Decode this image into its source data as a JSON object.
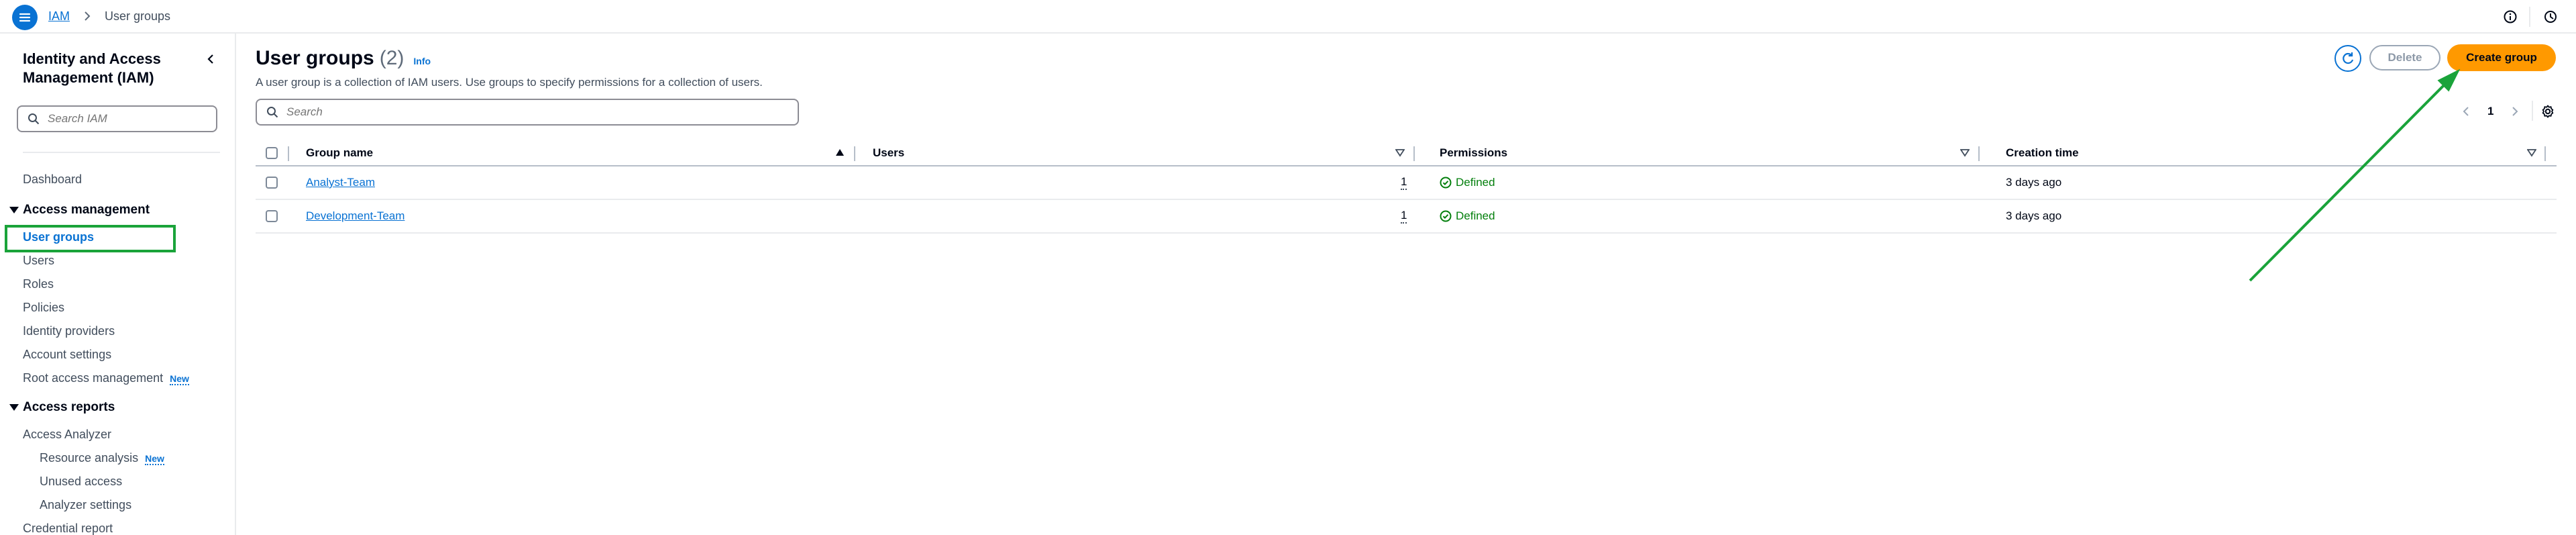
{
  "breadcrumb": {
    "root": "IAM",
    "current": "User groups"
  },
  "sidebar": {
    "title": "Identity and Access Management (IAM)",
    "search_placeholder": "Search IAM",
    "dashboard": "Dashboard",
    "access_management": {
      "label": "Access management",
      "items": [
        "User groups",
        "Users",
        "Roles",
        "Policies",
        "Identity providers",
        "Account settings",
        "Root access management"
      ],
      "root_badge": "New"
    },
    "access_reports": {
      "label": "Access reports",
      "analyzer": "Access Analyzer",
      "sub_items": [
        "Resource analysis",
        "Unused access",
        "Analyzer settings"
      ],
      "resource_badge": "New",
      "credential_report": "Credential report"
    }
  },
  "header": {
    "title": "User groups",
    "count": "(2)",
    "info": "Info",
    "description": "A user group is a collection of IAM users. Use groups to specify permissions for a collection of users."
  },
  "actions": {
    "delete": "Delete",
    "create": "Create group"
  },
  "search": {
    "placeholder": "Search"
  },
  "pagination": {
    "page": "1"
  },
  "table": {
    "columns": [
      "Group name",
      "Users",
      "Permissions",
      "Creation time"
    ],
    "rows": [
      {
        "name": "Analyst-Team",
        "users": "1",
        "permissions": "Defined",
        "created": "3 days ago"
      },
      {
        "name": "Development-Team",
        "users": "1",
        "permissions": "Defined",
        "created": "3 days ago"
      }
    ]
  },
  "colors": {
    "accent": "#0972d3",
    "primary_button": "#ff9900",
    "success": "#037f0c",
    "annotation": "#1aa33a"
  }
}
